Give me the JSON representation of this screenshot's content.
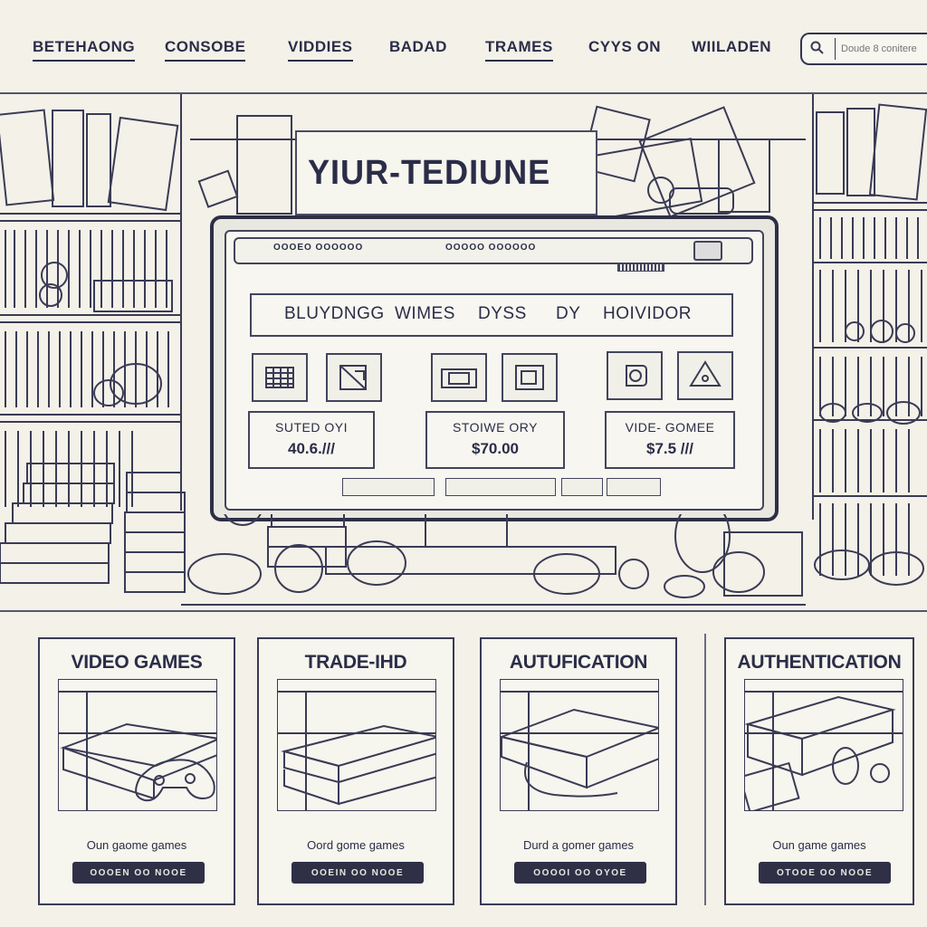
{
  "nav": {
    "items": [
      "BETEHAONG",
      "CONSOBE",
      "VIDDIES",
      "BADAD",
      "TRAMES",
      "CYYS ON",
      "WIILADEN"
    ],
    "search_placeholder": "Doude 8 conitere"
  },
  "hero": {
    "title": "YIUR-TEDIUNE",
    "browser": {
      "url_left": "OOOEO OOOOOO",
      "url_center": "OOOOO OOOOOO"
    },
    "tagline": [
      "BLUYDNGG",
      "WIMES",
      "DYSS",
      "DY",
      "HOIVIDOR"
    ],
    "price_cards": [
      {
        "label": "SUTED OYI",
        "value": "40.6.///"
      },
      {
        "label": "STOIWE ORY",
        "value": "$70.00"
      },
      {
        "label": "VIDE- GOMEE",
        "value": "$7.5 ///"
      }
    ]
  },
  "cards": [
    {
      "title": "VIDEO GAMES",
      "desc": "Oun gaome games",
      "button": "OOOEN OO NOOE"
    },
    {
      "title": "TRADE-IHD",
      "desc": "Oord gome games",
      "button": "OOEIN OO NOOE"
    },
    {
      "title": "AUTUFICATION",
      "desc": "Durd a gomer games",
      "button": "OOOOI OO OYOE"
    },
    {
      "title": "AUTHENTICATION",
      "desc": "Oun game games",
      "button": "OTOOE OO NOOE"
    }
  ],
  "colors": {
    "ink": "#2b2d48",
    "paper": "#f3f1e8",
    "button": "#2f3046"
  },
  "icons": [
    "search-icon",
    "cart-icon",
    "box-icon",
    "cash-icon",
    "photo-icon",
    "disc-icon",
    "warning-icon",
    "console-icon",
    "controller-icon"
  ]
}
